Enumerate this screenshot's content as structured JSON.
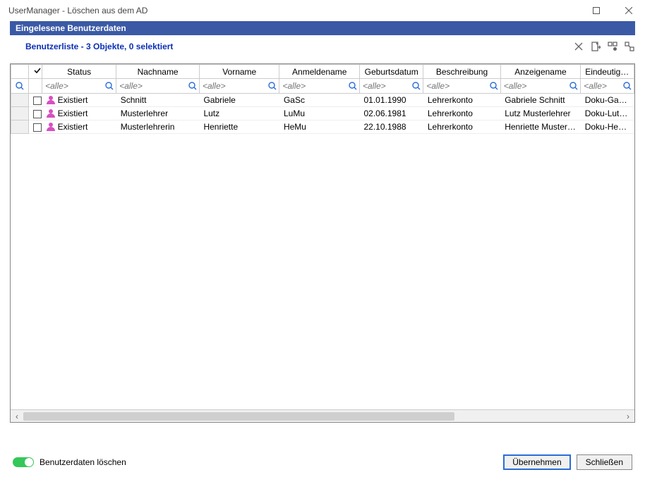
{
  "window": {
    "title": "UserManager - Löschen aus dem AD"
  },
  "band": {
    "title": "Eingelesene Benutzerdaten"
  },
  "listHeader": {
    "text": "Benutzerliste - 3 Objekte, 0 selektiert"
  },
  "columns": {
    "status": "Status",
    "nachname": "Nachname",
    "vorname": "Vorname",
    "anmeldename": "Anmeldename",
    "geburtsdatum": "Geburtsdatum",
    "beschreibung": "Beschreibung",
    "anzeigename": "Anzeigename",
    "eindeutigeId": "Eindeutige ID"
  },
  "filter": {
    "placeholder": "<alle>"
  },
  "rows": [
    {
      "status": "Existiert",
      "nachname": "Schnitt",
      "vorname": "Gabriele",
      "anmeldename": "GaSc",
      "geburtsdatum": "01.01.1990",
      "beschreibung": "Lehrerkonto",
      "anzeigename": "Gabriele Schnitt",
      "eindeutigeId": "Doku-Gabriel..."
    },
    {
      "status": "Existiert",
      "nachname": "Musterlehrer",
      "vorname": "Lutz",
      "anmeldename": "LuMu",
      "geburtsdatum": "02.06.1981",
      "beschreibung": "Lehrerkonto",
      "anzeigename": "Lutz Musterlehrer",
      "eindeutigeId": "Doku-LutzM..."
    },
    {
      "status": "Existiert",
      "nachname": "Musterlehrerin",
      "vorname": "Henriette",
      "anmeldename": "HeMu",
      "geburtsdatum": "22.10.1988",
      "beschreibung": "Lehrerkonto",
      "anzeigename": "Henriette Musterleh...",
      "eindeutigeId": "Doku-Henriet..."
    }
  ],
  "bottom": {
    "toggleLabel": "Benutzerdaten löschen",
    "apply": "Übernehmen",
    "close": "Schließen"
  }
}
